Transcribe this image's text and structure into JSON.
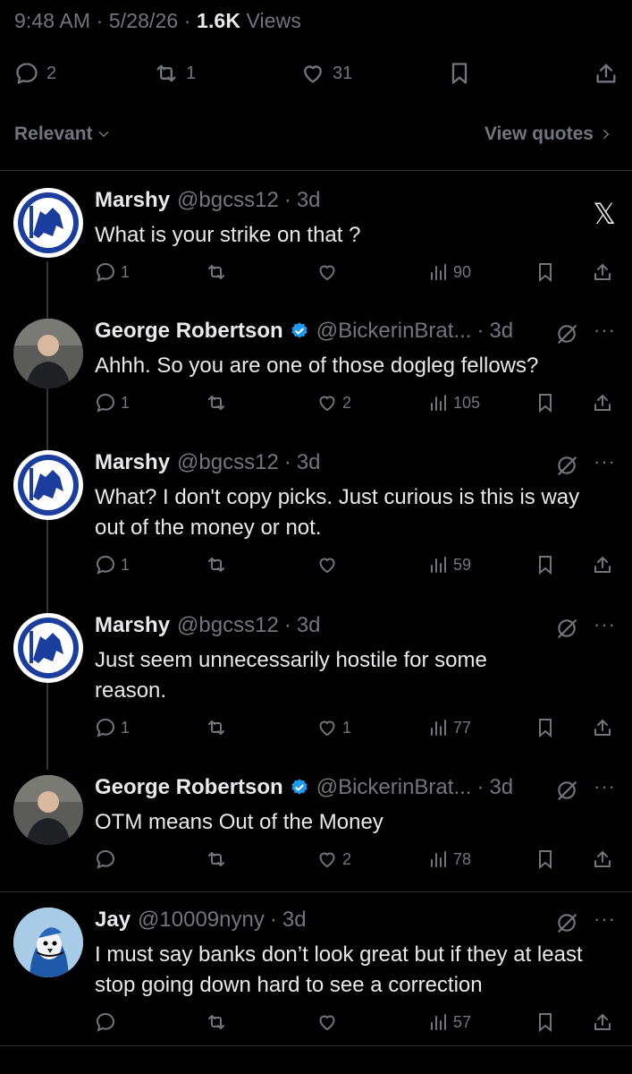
{
  "tweet_meta": {
    "time": "9:48 AM",
    "date": "5/28/26",
    "views_count": "1.6K",
    "views_label": "Views"
  },
  "tweet_actions": {
    "replies": "2",
    "reposts": "1",
    "likes": "31"
  },
  "filter": {
    "sort_label": "Relevant",
    "quotes_label": "View quotes"
  },
  "replies": [
    {
      "name": "Marshy",
      "handle": "@bgcss12",
      "time": "3d",
      "text": "What is your strike on that ?",
      "replies": "1",
      "reposts": "",
      "likes": "",
      "views": "90"
    },
    {
      "name": "George Robertson",
      "handle": "@BickerinBrat...",
      "time": "3d",
      "text": "Ahhh.  So you are one of those dogleg fellows?",
      "replies": "1",
      "reposts": "",
      "likes": "2",
      "views": "105"
    },
    {
      "name": "Marshy",
      "handle": "@bgcss12",
      "time": "3d",
      "text": "What?  I don't copy picks.  Just curious is this is way out of the money or not.",
      "replies": "1",
      "reposts": "",
      "likes": "",
      "views": "59"
    },
    {
      "name": "Marshy",
      "handle": "@bgcss12",
      "time": "3d",
      "text": "Just seem unnecessarily hostile for some reason.",
      "replies": "1",
      "reposts": "",
      "likes": "1",
      "views": "77"
    },
    {
      "name": "George Robertson",
      "handle": "@BickerinBrat...",
      "time": "3d",
      "text": "OTM means Out of the Money",
      "replies": "",
      "reposts": "",
      "likes": "2",
      "views": "78"
    },
    {
      "name": "Jay",
      "handle": "@10009nyny",
      "time": "3d",
      "text": "I must say banks don’t look great but if they at least stop going down hard to see a correction",
      "replies": "",
      "reposts": "",
      "likes": "",
      "views": "57"
    }
  ],
  "colors": {
    "background": "#000000",
    "text": "#e7e9ea",
    "muted": "#71767b",
    "verified": "#1d9bf0",
    "divider": "#2f3336"
  }
}
